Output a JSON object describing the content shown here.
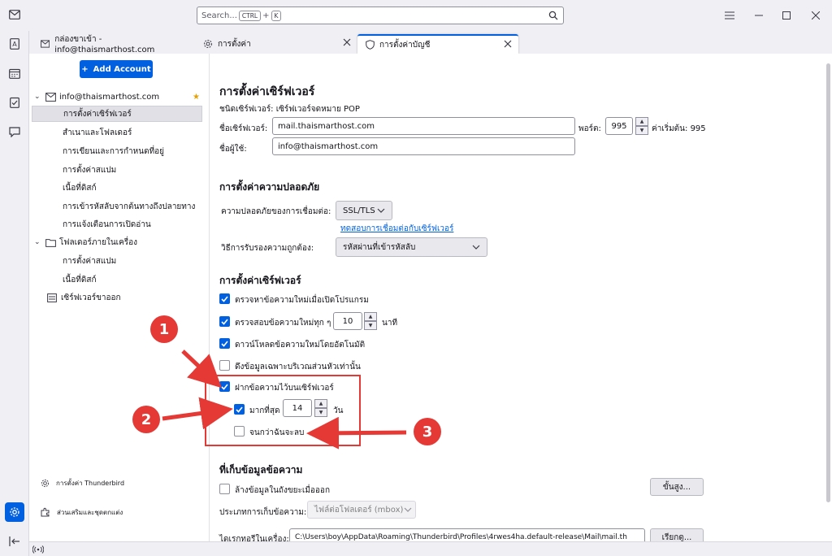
{
  "titlebar": {
    "search_placeholder": "Search...",
    "kbd_ctrl": "CTRL",
    "kbd_plus": "+",
    "kbd_k": "K"
  },
  "tabs": [
    {
      "label": "กล่องขาเข้า - info@thaismarthost.com"
    },
    {
      "label": "การตั้งค่า"
    },
    {
      "label": "การตั้งค่าบัญชี"
    }
  ],
  "sidebar": {
    "add_account": "Add Account",
    "account": "info@thaismarthost.com",
    "items": [
      {
        "label": "การตั้งค่าเซิร์ฟเวอร์"
      },
      {
        "label": "สำเนาและโฟลเดอร์"
      },
      {
        "label": "การเขียนและการกำหนดที่อยู่"
      },
      {
        "label": "การตั้งค่าสแปม"
      },
      {
        "label": "เนื้อที่ดิสก์"
      },
      {
        "label": "การเข้ารหัสลับจากต้นทางถึงปลายทาง"
      },
      {
        "label": "การแจ้งเตือนการเปิดอ่าน"
      }
    ],
    "local_folders": "โฟลเดอร์ภายในเครื่อง",
    "local_items": [
      {
        "label": "การตั้งค่าสแปม"
      },
      {
        "label": "เนื้อที่ดิสก์"
      }
    ],
    "outgoing": "เซิร์ฟเวอร์ขาออก",
    "thunderbird_settings": "การตั้งค่า Thunderbird",
    "addons": "ส่วนเสริมและชุดตกแต่ง"
  },
  "main": {
    "title": "การตั้งค่าเซิร์ฟเวอร์",
    "server_type": "ชนิดเซิร์ฟเวอร์: เซิร์ฟเวอร์จดหมาย POP",
    "server_name_label": "ชื่อเซิร์ฟเวอร์:",
    "server_name": "mail.thaismarthost.com",
    "port_label": "พอร์ต:",
    "port": "995",
    "default_port": "ค่าเริ่มต้น: 995",
    "username_label": "ชื่อผู้ใช้:",
    "username": "info@thaismarthost.com",
    "security": {
      "title": "การตั้งค่าความปลอดภัย",
      "conn_label": "ความปลอดภัยของการเชื่อมต่อ:",
      "conn_value": "SSL/TLS",
      "test_link": "ทดสอบการเชื่อมต่อกับเซิร์ฟเวอร์",
      "auth_label": "วิธีการรับรองความถูกต้อง:",
      "auth_value": "รหัสผ่านที่เข้ารหัสลับ"
    },
    "server_settings": {
      "title": "การตั้งค่าเซิร์ฟเวอร์",
      "check_startup": "ตรวจหาข้อความใหม่เมื่อเปิดโปรแกรม",
      "check_every": "ตรวจสอบข้อความใหม่ทุก ๆ",
      "check_minutes": "10",
      "minutes_unit": "นาที",
      "auto_download": "ดาวน์โหลดข้อความใหม่โดยอัตโนมัติ",
      "headers_only": "ดึงข้อมูลเฉพาะบริเวณส่วนหัวเท่านั้น",
      "leave_on_server": "ฝากข้อความไว้บนเซิร์ฟเวอร์",
      "at_most": "มากที่สุด",
      "at_most_days": "14",
      "days_unit": "วัน",
      "until_deleted": "จนกว่าฉันจะลบ"
    },
    "storage": {
      "title": "ที่เก็บข้อมูลข้อความ",
      "empty_trash": "ล้างข้อมูลในถังขยะเมื่อออก",
      "advanced": "ขั้นสูง...",
      "store_type_label": "ประเภทการเก็บข้อความ:",
      "store_type": "ไฟล์ต่อโฟลเดอร์ (mbox)",
      "local_dir_label": "ไดเรกทอรีในเครื่อง:",
      "local_dir": "C:\\Users\\boy\\AppData\\Roaming\\Thunderbird\\Profiles\\4rwes4ha.default-release\\Mail\\mail.th",
      "browse": "เรียกดู..."
    }
  },
  "annotations": {
    "m1": "1",
    "m2": "2",
    "m3": "3",
    "color": "#e53935"
  },
  "colors": {
    "accent": "#0060df",
    "annotation": "#e53935"
  }
}
